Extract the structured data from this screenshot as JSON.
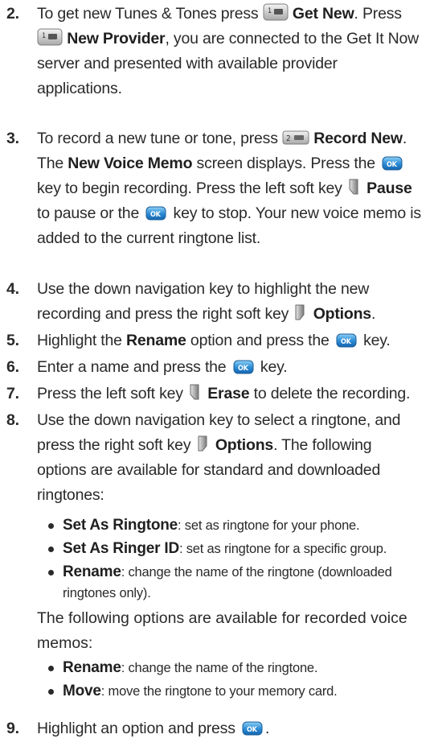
{
  "steps": {
    "s2": {
      "num": "2.",
      "t1": "To get new Tunes & Tones press",
      "b1": "Get New",
      "t2": ". Press",
      "b2": "New Provider",
      "t3": ", you are connected to the Get It Now server and presented with available provider applications."
    },
    "s3": {
      "num": "3.",
      "t1": "To record a new tune or tone, press",
      "b1": "Record New",
      "t2": ". The",
      "b2": "New Voice Memo",
      "t3": "screen displays. Press the",
      "t4": "key to begin recording. Press the left soft key",
      "b3": "Pause",
      "t5": "to pause or the",
      "t6": "key to stop. Your new voice memo is added to the current ringtone list."
    },
    "s4": {
      "num": "4.",
      "t1": "Use the down navigation key to highlight the new recording and press the right soft key",
      "b1": "Options",
      "t2": "."
    },
    "s5": {
      "num": "5.",
      "t1": "Highlight the",
      "b1": "Rename",
      "t2": "option and press the",
      "t3": "key."
    },
    "s6": {
      "num": "6.",
      "t1": "Enter a name and press the",
      "t2": "key."
    },
    "s7": {
      "num": "7.",
      "t1": "Press the left soft key",
      "b1": "Erase",
      "t2": "to delete the recording."
    },
    "s8": {
      "num": "8.",
      "t1": "Use the down navigation key to select a ringtone, and press the right soft key",
      "b1": "Options",
      "t2": ". The following options are available for standard and downloaded ringtones:"
    },
    "s9": {
      "num": "9.",
      "t1": "Highlight an option and press",
      "t2": "."
    }
  },
  "bullets_a": [
    {
      "label": "Set As Ringtone",
      "desc": ": set as ringtone for your phone."
    },
    {
      "label": "Set As Ringer ID",
      "desc": ": set as ringtone for a specific group."
    },
    {
      "label": "Rename",
      "desc": ": change the name of the ringtone (downloaded ringtones only)."
    }
  ],
  "para_recorded": "The following options are available for recorded voice memos:",
  "bullets_b": [
    {
      "label": "Rename",
      "desc": ": change the name of the ringtone."
    },
    {
      "label": "Move",
      "desc": ": move the ringtone to your memory card."
    }
  ],
  "key_icons": {
    "key1": "key-1-icon",
    "key2": "key-2-abc-icon",
    "ok": "ok-key-icon",
    "left_soft": "left-soft-key-icon",
    "right_soft": "right-soft-key-icon"
  },
  "colors": {
    "ok_key": "#2f8fd6",
    "key_gray": "#9a9a9a",
    "text": "#2a2a2a"
  }
}
